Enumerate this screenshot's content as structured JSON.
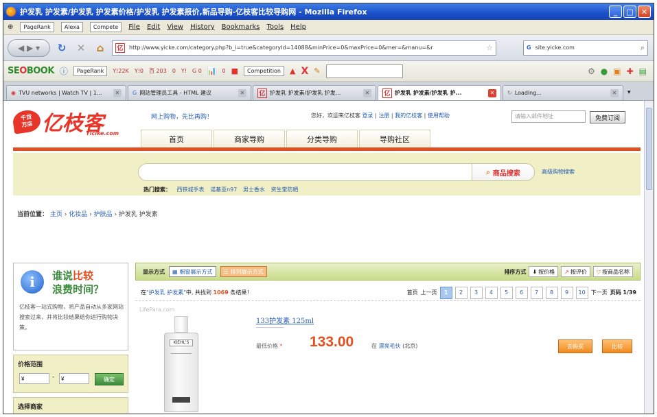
{
  "window": {
    "title": "护发乳 护发素/护发乳 护发素价格/护发乳 护发素报价,新品导购-亿枝客比较导购网 - Mozilla Firefox",
    "min": "_",
    "max": "□",
    "close": "✕"
  },
  "menu": {
    "pagerank": "PageRank",
    "alexa": "Alexa",
    "compete": "Compete",
    "items": [
      "File",
      "Edit",
      "View",
      "History",
      "Bookmarks",
      "Tools",
      "Help"
    ]
  },
  "nav": {
    "url": "http://www.yicke.com/category.php?b_i=true&categoryId=14088&minPrice=0&maxPrice=0&mer=&manu=&r",
    "search_value": "site:yicke.com"
  },
  "seo": {
    "logo_a": "SE",
    "logo_b": "O",
    "logo_c": "BOOK",
    "pagerank": "PageRank",
    "stats": [
      "Y!22K",
      "Y!0",
      "百 203",
      "0",
      "Y!",
      "G 0",
      "",
      "0",
      ""
    ],
    "competition": "Competition"
  },
  "tabs": [
    {
      "label": "TVU networks | Watch TV | 1...",
      "active": false
    },
    {
      "label": "网站管理员工具 - HTML 建议",
      "active": false
    },
    {
      "label": "护发乳 护发素/护发乳 护发...",
      "active": false
    },
    {
      "label": "护发乳 护发素/护发乳 护...",
      "active": true
    },
    {
      "label": "Loading...",
      "active": false
    }
  ],
  "site": {
    "logo_badge_1": "千货",
    "logo_badge_2": "万店",
    "logo_text": "亿枝客",
    "logo_sub": "Yicike.com",
    "slogan": "网上购物，先比再购！",
    "welcome": "您好，欢迎来亿枝客",
    "login": "登录",
    "register": "注册",
    "my": "我的亿枝客",
    "help": "使用帮助",
    "email_placeholder": "请输入邮件地址",
    "subscribe": "免费订阅",
    "main_nav": [
      "首页",
      "商家导购",
      "分类导购",
      "导购社区"
    ],
    "search_btn": "商品搜索",
    "adv_search": "高级购物搜索",
    "hot_label": "热门搜索：",
    "hot_items": [
      "西铁城手表",
      "诺基亚n97",
      "男士香水",
      "资生堂防晒"
    ],
    "breadcrumb_label": "当前位置：",
    "breadcrumb": [
      "主页",
      "化妆品",
      "护肤品",
      "护发乳 护发素"
    ],
    "promo_title_1": "谁说",
    "promo_title_red": "比较",
    "promo_title_2": "浪费时间？",
    "promo_text": "亿枝客一站式购物，将产品自动从多家网站搜索过来，并将比较结果给你进行购物决策。",
    "price_range": "价格范围",
    "price_from": "¥",
    "price_to": "¥",
    "price_dash": "-",
    "go": "确定",
    "mall_select": "选择商家"
  },
  "results": {
    "display_label": "显示方式",
    "view_grid": "橱窗展示方式",
    "view_list": "排列展示方式",
    "sort_label": "排序方式",
    "sort_price": "按价格",
    "sort_rating": "按评价",
    "sort_name": "按商品名称",
    "count_pre": "在",
    "keyword": "\"护发乳 护发素\"",
    "count_mid": "中, 共找到",
    "count": "1069",
    "count_post": "条结果！",
    "first": "首页",
    "prev": "上一页",
    "pages": [
      "1",
      "2",
      "3",
      "4",
      "5",
      "6",
      "7",
      "8",
      "9",
      "10"
    ],
    "next": "下一页",
    "page_info": "页码 1/39"
  },
  "product": {
    "watermark": "LifePara.com",
    "title": "133护发素 125ml",
    "price_label": "最低价格",
    "price_star": "*",
    "price": "133.00",
    "shop_pre": "在",
    "shop": "漂亮毛伙",
    "shop_post": "(北京)",
    "compare": "去购买",
    "buy": "比较",
    "bottle_label": "KIEHL'S"
  }
}
